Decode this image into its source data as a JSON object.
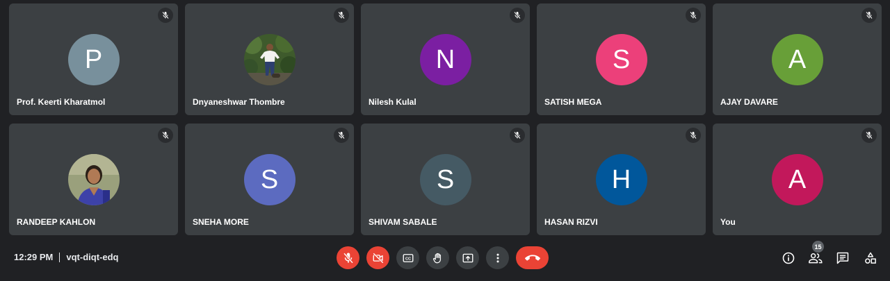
{
  "participants": [
    {
      "name": "Prof. Keerti Kharatmol",
      "initial": "P",
      "color": "#78909c",
      "photo": false,
      "muted": true
    },
    {
      "name": "Dnyaneshwar Thombre",
      "initial": "",
      "color": "#3b5a32",
      "photo": true,
      "muted": true
    },
    {
      "name": "Nilesh Kulal",
      "initial": "N",
      "color": "#7b1fa2",
      "photo": false,
      "muted": true
    },
    {
      "name": "SATISH MEGA",
      "initial": "S",
      "color": "#ec407a",
      "photo": false,
      "muted": true
    },
    {
      "name": "AJAY DAVARE",
      "initial": "A",
      "color": "#689f38",
      "photo": false,
      "muted": true
    },
    {
      "name": "RANDEEP KAHLON",
      "initial": "",
      "color": "#8a8f78",
      "photo": true,
      "muted": true
    },
    {
      "name": "SNEHA MORE",
      "initial": "S",
      "color": "#5c6bc0",
      "photo": false,
      "muted": true
    },
    {
      "name": "SHIVAM SABALE",
      "initial": "S",
      "color": "#455a64",
      "photo": false,
      "muted": true
    },
    {
      "name": "HASAN RIZVI",
      "initial": "H",
      "color": "#01579b",
      "photo": false,
      "muted": true
    },
    {
      "name": "You",
      "initial": "A",
      "color": "#c2185b",
      "photo": false,
      "muted": true
    }
  ],
  "meeting": {
    "time": "12:29 PM",
    "code": "vqt-diqt-edq"
  },
  "controls": [
    {
      "id": "mic",
      "icon": "mic-off-icon",
      "active_off": true
    },
    {
      "id": "camera",
      "icon": "camera-off-icon",
      "active_off": true
    },
    {
      "id": "captions",
      "icon": "captions-icon",
      "active_off": false
    },
    {
      "id": "raise-hand",
      "icon": "raise-hand-icon",
      "active_off": false
    },
    {
      "id": "present",
      "icon": "present-screen-icon",
      "active_off": false
    },
    {
      "id": "more",
      "icon": "more-options-icon",
      "active_off": false
    },
    {
      "id": "leave",
      "icon": "leave-call-icon",
      "active_off": false
    }
  ],
  "right_panel": {
    "participant_count": "15",
    "icons": [
      "info-icon",
      "people-icon",
      "chat-icon",
      "activities-icon"
    ]
  },
  "colors": {
    "background": "#202124",
    "tile": "#3c4043",
    "danger": "#ea4335"
  }
}
